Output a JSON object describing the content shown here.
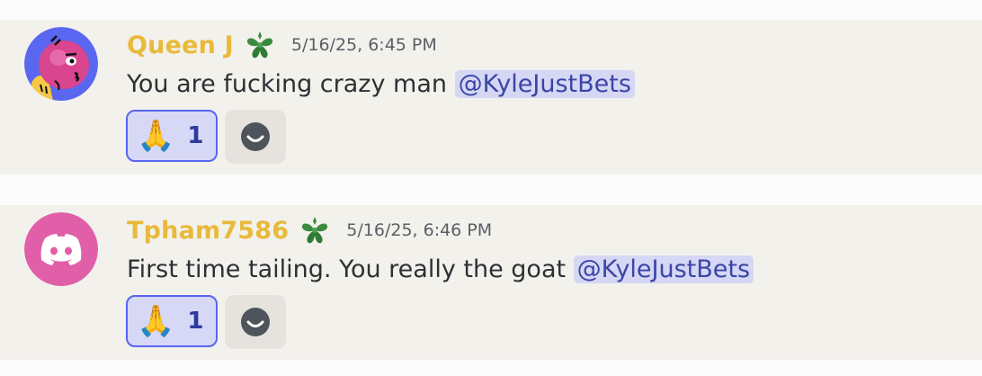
{
  "messages": [
    {
      "username": "Queen J",
      "timestamp": "5/16/25, 6:45 PM",
      "text": "You are fucking crazy man ",
      "mention": "@KyleJustBets",
      "reaction": {
        "emoji": "🙏",
        "count": "1"
      },
      "avatar": "pink-character-avatar",
      "badge": "green-leaf-badge-icon"
    },
    {
      "username": "Tpham7586",
      "timestamp": "5/16/25, 6:46 PM",
      "text": "First time tailing. You really the goat ",
      "mention": "@KyleJustBets",
      "reaction": {
        "emoji": "🙏",
        "count": "1"
      },
      "avatar": "discord-logo-avatar",
      "badge": "green-leaf-badge-icon"
    }
  ],
  "colors": {
    "username": "#e9b93a",
    "mention_bg": "#d5d7f4",
    "mention_text": "#3b45a6",
    "reaction_border": "#5865f2",
    "discord_pink": "#e05fa8"
  }
}
